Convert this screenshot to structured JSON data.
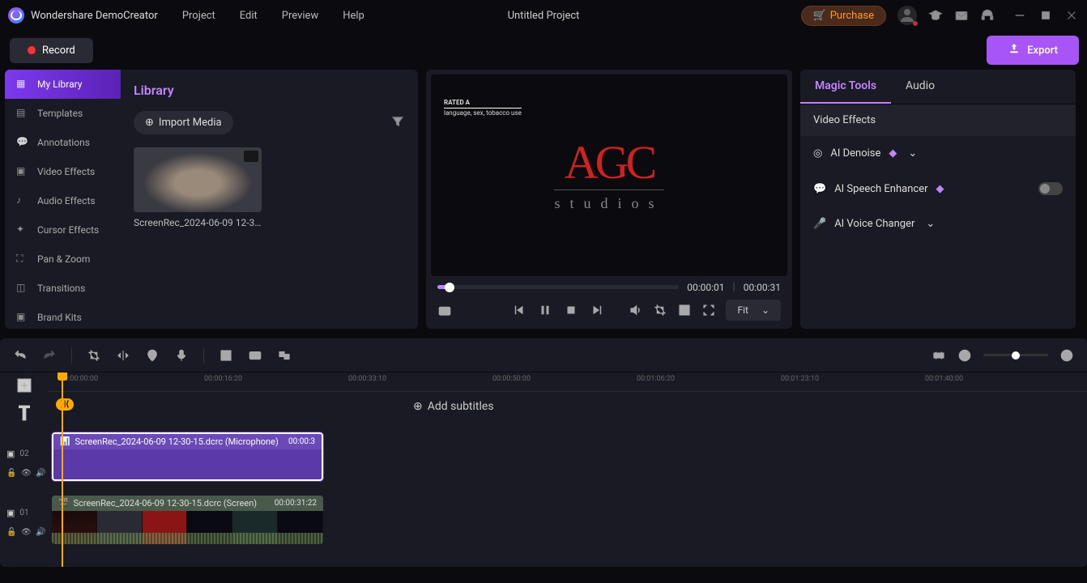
{
  "app": {
    "name": "Wondershare DemoCreator",
    "project_title": "Untitled Project"
  },
  "menu": [
    "Project",
    "Edit",
    "Preview",
    "Help"
  ],
  "purchase": "Purchase",
  "record": "Record",
  "export": "Export",
  "sidebar": {
    "items": [
      "My Library",
      "Templates",
      "Annotations",
      "Video Effects",
      "Audio Effects",
      "Cursor Effects",
      "Pan & Zoom",
      "Transitions",
      "Brand Kits"
    ]
  },
  "library": {
    "title": "Library",
    "import": "Import Media",
    "media_name": "ScreenRec_2024-06-09 12-30..."
  },
  "preview": {
    "logo_text": "AGC",
    "logo_sub": "studios",
    "rating_line1": "RATED A",
    "rating_line2": "language, sex, tobacco use",
    "current": "00:00:01",
    "total": "00:00:31",
    "fit": "Fit"
  },
  "right_panel": {
    "tab1": "Magic Tools",
    "tab2": "Audio",
    "section": "Video Effects",
    "denoise": "AI Denoise",
    "speech": "AI Speech Enhancer",
    "voice": "AI Voice Changer"
  },
  "timeline": {
    "ruler": [
      "00:00:00:00",
      "00:00:16:20",
      "00:00:33:10",
      "00:00:50:00",
      "00:01:06:20",
      "00:01:23:10",
      "00:01:40:00"
    ],
    "sub_marker": "⟩|⟨",
    "add_subtitles": "Add subtitles",
    "clip1_name": "ScreenRec_2024-06-09 12-30-15.dcrc (Microphone)",
    "clip1_dur": "00:00:3",
    "clip2_name": "ScreenRec_2024-06-09 12-30-15.dcrc (Screen)",
    "clip2_dur": "00:00:31:22",
    "track1": "01",
    "track2": "02"
  }
}
